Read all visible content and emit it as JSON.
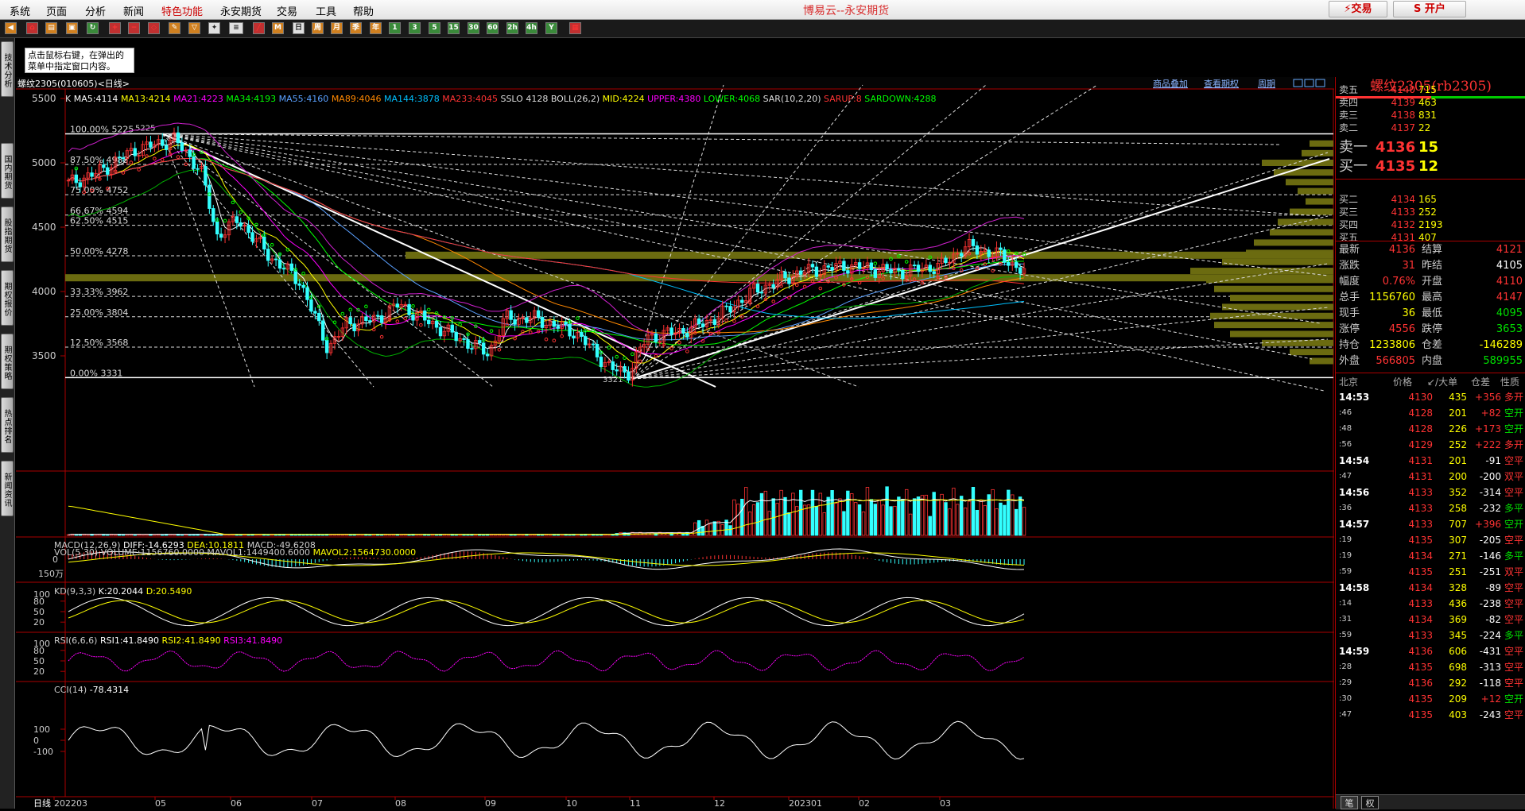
{
  "app": {
    "title": "博易云--永安期货",
    "menu": [
      "系统",
      "页面",
      "分析",
      "新闻",
      "特色功能",
      "永安期货",
      "交易",
      "工具",
      "帮助"
    ],
    "btn_trade": "⚡交易",
    "btn_right": "S 开户"
  },
  "toolbar_icons": [
    "1",
    "3",
    "5",
    "15",
    "30",
    "60",
    "2h",
    "4h",
    "日",
    "周",
    "月",
    "季",
    "年"
  ],
  "leftnav": [
    "技术分析",
    "国内期货",
    "股指期货",
    "期权报价",
    "期权策略",
    "热点排名",
    "新闻资讯"
  ],
  "tip": "点击鼠标右键，在弹出的菜单中指定窗口内容。",
  "chart": {
    "header": "螺纹2305(010605)<日线>",
    "links": [
      "商品叠加",
      "查看期权",
      "周期"
    ],
    "ma_line": [
      {
        "t": "K",
        "c": "#dddddd"
      },
      {
        "t": "MA5:4114",
        "c": "#ffffff"
      },
      {
        "t": "MA13:4214",
        "c": "#ffff00"
      },
      {
        "t": "MA21:4223",
        "c": "#ff00ff"
      },
      {
        "t": "MA34:4193",
        "c": "#00ff00"
      },
      {
        "t": "MA55:4160",
        "c": "#5aa0ff"
      },
      {
        "t": "MA89:4046",
        "c": "#ff8800"
      },
      {
        "t": "MA144:3878",
        "c": "#00c0ff"
      },
      {
        "t": "MA233:4045",
        "c": "#ff3333"
      },
      {
        "t": "SSLO 4128",
        "c": "#dddddd"
      },
      {
        "t": "BOLL(26,2)",
        "c": "#dddddd"
      },
      {
        "t": "MID:4224",
        "c": "#ffff00"
      },
      {
        "t": "UPPER:4380",
        "c": "#ff00ff"
      },
      {
        "t": "LOWER:4068",
        "c": "#00ff00"
      },
      {
        "t": "SAR(10,2,20)",
        "c": "#dddddd"
      },
      {
        "t": "SARUP:8",
        "c": "#ff3333"
      },
      {
        "t": "SARDOWN:4288",
        "c": "#00ff00"
      }
    ],
    "yticks": [
      "5500",
      "5000",
      "4500",
      "4000",
      "3500"
    ],
    "fib": [
      {
        "l": "100.00%",
        "v": "5225"
      },
      {
        "l": "87.50%",
        "v": "4988"
      },
      {
        "l": "75.00%",
        "v": "4752"
      },
      {
        "l": "66.67%",
        "v": "4594"
      },
      {
        "l": "62.50%",
        "v": "4515"
      },
      {
        "l": "50.00%",
        "v": "4278"
      },
      {
        "l": "33.33%",
        "v": "3962"
      },
      {
        "l": "25.00%",
        "v": "3804"
      },
      {
        "l": "12.50%",
        "v": "3568"
      },
      {
        "l": "0.00%",
        "v": "3331"
      }
    ],
    "high_label": "5225",
    "low_label": "3321",
    "vol_header": {
      "a": "VOL(5,30) VOLUME:1156760.0000 MAVOL1:1449400.6000",
      "b": "MAVOL2:1564730.0000"
    },
    "vol_tick": "150万",
    "macd_header": {
      "a": "MACD(12,26,9)",
      "b": "DIFF:-14.6293",
      "c": "DEA:10.1811",
      "d": "MACD:-49.6208"
    },
    "macd_tick": "0",
    "kd_header": {
      "a": "KD(9,3,3)",
      "b": "K:20.2044",
      "c": "D:20.5490"
    },
    "kd_ticks": [
      "100",
      "80",
      "50",
      "20"
    ],
    "rsi_header": {
      "a": "RSI(6,6,6)",
      "b": "RSI1:41.8490",
      "c": "RSI2:41.8490",
      "d": "RSI3:41.8490"
    },
    "rsi_ticks": [
      "100",
      "80",
      "50",
      "20"
    ],
    "cci_header": {
      "a": "CCI(14)",
      "b": "-78.4314"
    },
    "cci_ticks": [
      "100",
      "0",
      "-100"
    ],
    "xaxis": [
      "日线",
      "202203",
      "05",
      "06",
      "07",
      "08",
      "09",
      "10",
      "11",
      "12",
      "202301",
      "02",
      "03"
    ]
  },
  "quote": {
    "title": "螺纹2305(rb2305)",
    "asks": [
      {
        "l": "卖五",
        "p": "4140",
        "v": "715"
      },
      {
        "l": "卖四",
        "p": "4139",
        "v": "463"
      },
      {
        "l": "卖三",
        "p": "4138",
        "v": "831"
      },
      {
        "l": "卖二",
        "p": "4137",
        "v": "22"
      },
      {
        "l": "卖一",
        "p": "4136",
        "v": "15"
      }
    ],
    "bids": [
      {
        "l": "买一",
        "p": "4135",
        "v": "12"
      },
      {
        "l": "买二",
        "p": "4134",
        "v": "165"
      },
      {
        "l": "买三",
        "p": "4133",
        "v": "252"
      },
      {
        "l": "买四",
        "p": "4132",
        "v": "2193"
      },
      {
        "l": "买五",
        "p": "4131",
        "v": "407"
      }
    ],
    "stats": [
      {
        "a": "最新",
        "b": "4136",
        "bc": "red",
        "c": "结算",
        "d": "4121",
        "dc": "red"
      },
      {
        "a": "涨跌",
        "b": "31",
        "bc": "red",
        "c": "昨结",
        "d": "4105",
        "dc": "wht"
      },
      {
        "a": "幅度",
        "b": "0.76%",
        "bc": "red",
        "c": "开盘",
        "d": "4110",
        "dc": "red"
      },
      {
        "a": "总手",
        "b": "1156760",
        "bc": "yel",
        "c": "最高",
        "d": "4147",
        "dc": "red"
      },
      {
        "a": "现手",
        "b": "36",
        "bc": "yel",
        "c": "最低",
        "d": "4095",
        "dc": "grn"
      },
      {
        "a": "涨停",
        "b": "4556",
        "bc": "red",
        "c": "跌停",
        "d": "3653",
        "dc": "grn"
      },
      {
        "a": "持仓",
        "b": "1233806",
        "bc": "yel",
        "c": "仓差",
        "d": "-146289",
        "dc": "yel"
      },
      {
        "a": "外盘",
        "b": "566805",
        "bc": "red",
        "c": "内盘",
        "d": "589955",
        "dc": "grn"
      }
    ],
    "tick_header": [
      "北京",
      "价格",
      "↙/大单",
      "仓差",
      "性质"
    ],
    "ticks": [
      {
        "t": "14:53",
        "p": "4130",
        "v": "435",
        "c": "+356",
        "n": "多开",
        "nc": "red"
      },
      {
        "t": ":46",
        "p": "4128",
        "v": "201",
        "c": "+82",
        "n": "空开",
        "nc": "grn"
      },
      {
        "t": ":48",
        "p": "4128",
        "v": "226",
        "c": "+173",
        "n": "空开",
        "nc": "grn"
      },
      {
        "t": ":56",
        "p": "4129",
        "v": "252",
        "c": "+222",
        "n": "多开",
        "nc": "red"
      },
      {
        "t": "14:54",
        "p": "4131",
        "v": "201",
        "c": "-91",
        "n": "空平",
        "nc": "red"
      },
      {
        "t": ":47",
        "p": "4131",
        "v": "200",
        "c": "-200",
        "n": "双平",
        "nc": "red"
      },
      {
        "t": "14:56",
        "p": "4133",
        "v": "352",
        "c": "-314",
        "n": "空平",
        "nc": "red"
      },
      {
        "t": ":36",
        "p": "4133",
        "v": "258",
        "c": "-232",
        "n": "多平",
        "nc": "grn"
      },
      {
        "t": "14:57",
        "p": "4133",
        "v": "707",
        "c": "+396",
        "n": "空开",
        "nc": "grn"
      },
      {
        "t": ":19",
        "p": "4135",
        "v": "307",
        "c": "-205",
        "n": "空平",
        "nc": "red"
      },
      {
        "t": ":19",
        "p": "4134",
        "v": "271",
        "c": "-146",
        "n": "多平",
        "nc": "grn"
      },
      {
        "t": ":59",
        "p": "4135",
        "v": "251",
        "c": "-251",
        "n": "双平",
        "nc": "red"
      },
      {
        "t": "14:58",
        "p": "4134",
        "v": "328",
        "c": "-89",
        "n": "空平",
        "nc": "red"
      },
      {
        "t": ":14",
        "p": "4133",
        "v": "436",
        "c": "-238",
        "n": "空平",
        "nc": "red"
      },
      {
        "t": ":31",
        "p": "4134",
        "v": "369",
        "c": "-82",
        "n": "空平",
        "nc": "red"
      },
      {
        "t": ":59",
        "p": "4133",
        "v": "345",
        "c": "-224",
        "n": "多平",
        "nc": "grn"
      },
      {
        "t": "14:59",
        "p": "4136",
        "v": "606",
        "c": "-431",
        "n": "空平",
        "nc": "red"
      },
      {
        "t": ":28",
        "p": "4135",
        "v": "698",
        "c": "-313",
        "n": "空平",
        "nc": "red"
      },
      {
        "t": ":29",
        "p": "4136",
        "v": "292",
        "c": "-118",
        "n": "空平",
        "nc": "red"
      },
      {
        "t": ":30",
        "p": "4135",
        "v": "209",
        "c": "+12",
        "n": "空开",
        "nc": "grn"
      },
      {
        "t": ":47",
        "p": "4135",
        "v": "403",
        "c": "-243",
        "n": "空平",
        "nc": "red"
      }
    ],
    "bottom_tabs": [
      "笔",
      "权"
    ]
  }
}
